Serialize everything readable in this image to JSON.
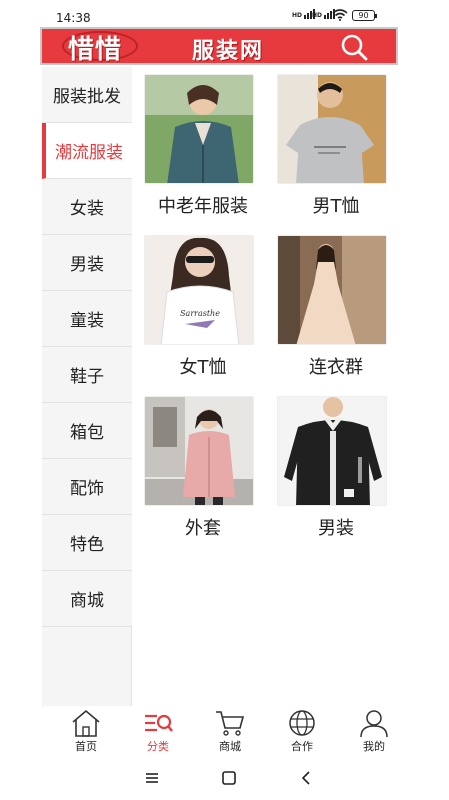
{
  "status_bar": {
    "time": "14:38",
    "battery": "90"
  },
  "header": {
    "logo": "惜惜",
    "title": "服装网",
    "search_icon": "search-icon"
  },
  "sidebar": {
    "items": [
      {
        "label": "服装批发",
        "active": false
      },
      {
        "label": "潮流服装",
        "active": true
      },
      {
        "label": "女装",
        "active": false
      },
      {
        "label": "男装",
        "active": false
      },
      {
        "label": "童装",
        "active": false
      },
      {
        "label": "鞋子",
        "active": false
      },
      {
        "label": "箱包",
        "active": false
      },
      {
        "label": "配饰",
        "active": false
      },
      {
        "label": "特色",
        "active": false
      },
      {
        "label": "商城",
        "active": false
      }
    ]
  },
  "products": [
    {
      "label": "中老年服装",
      "icon": "jacket-photo"
    },
    {
      "label": "男T恤",
      "icon": "tshirt-photo"
    },
    {
      "label": "女T恤",
      "icon": "tshirt-photo"
    },
    {
      "label": "连衣群",
      "icon": "dress-photo"
    },
    {
      "label": "外套",
      "icon": "coat-photo"
    },
    {
      "label": "男装",
      "icon": "shirt-photo"
    }
  ],
  "bottom_nav": {
    "items": [
      {
        "label": "首页",
        "icon": "home-icon"
      },
      {
        "label": "分类",
        "icon": "category-icon",
        "active": true
      },
      {
        "label": "商城",
        "icon": "cart-icon"
      },
      {
        "label": "合作",
        "icon": "globe-icon"
      },
      {
        "label": "我的",
        "icon": "user-icon"
      }
    ]
  },
  "colors": {
    "accent": "#e63a3e",
    "sidebar_bg": "#f5f5f5"
  }
}
